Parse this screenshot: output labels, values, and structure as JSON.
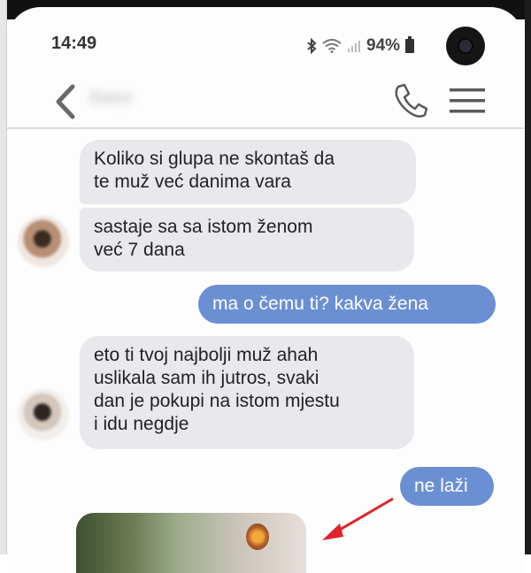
{
  "status_bar": {
    "time": "14:49",
    "battery": "94%"
  },
  "header": {
    "contact_name": "Sveco"
  },
  "messages": [
    {
      "direction": "incoming",
      "text": "Koliko si glupa ne skontaš da\nte muž već danima vara"
    },
    {
      "direction": "incoming",
      "text": "sastaje sa sa istom ženom\nveć 7 dana"
    },
    {
      "direction": "outgoing",
      "text": "ma o čemu ti? kakva žena"
    },
    {
      "direction": "incoming",
      "text": "eto ti tvoj najbolji muž ahah\nuslikala sam ih jutros, svaki\ndan je pokupi na istom mjestu\ni idu negdje"
    },
    {
      "direction": "outgoing",
      "text": "ne laži"
    }
  ],
  "colors": {
    "outgoing_bubble": "#6b8fd3",
    "incoming_bubble": "#e8e8ed",
    "annotation_arrow": "#e0222a"
  },
  "icons": [
    "back-arrow",
    "phone",
    "menu",
    "bluetooth",
    "wifi",
    "signal",
    "battery",
    "camera"
  ]
}
